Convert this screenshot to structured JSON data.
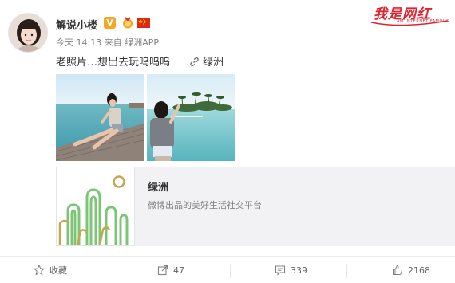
{
  "user": {
    "name": "解说小楼",
    "verified_badge": "V",
    "timestamp": "今天 14:13",
    "source": "来自 绿洲APP"
  },
  "watermark": {
    "logo_text": "我是网红",
    "logo_subtitle": "I AM INTERNET FAMOUS"
  },
  "post": {
    "text": "老照片…想出去玩呜呜呜",
    "link_label": "绿洲"
  },
  "card": {
    "title": "绿洲",
    "description": "微博出品的美好生活社交平台"
  },
  "toolbar": {
    "favorite_label": "收藏",
    "repost_count": "47",
    "comment_count": "339",
    "like_count": "2168"
  },
  "colors": {
    "accent": "#f5a623",
    "link": "#333333",
    "watermark": "#e0242f",
    "card_bg": "#f2f2f5",
    "oasis_green": "#7cc576",
    "oasis_gold": "#c9a552"
  },
  "icons": [
    "avatar",
    "verified-icon",
    "medal-icon",
    "china-flag-icon",
    "link-icon",
    "star-icon",
    "repost-icon",
    "comment-icon",
    "like-icon"
  ]
}
